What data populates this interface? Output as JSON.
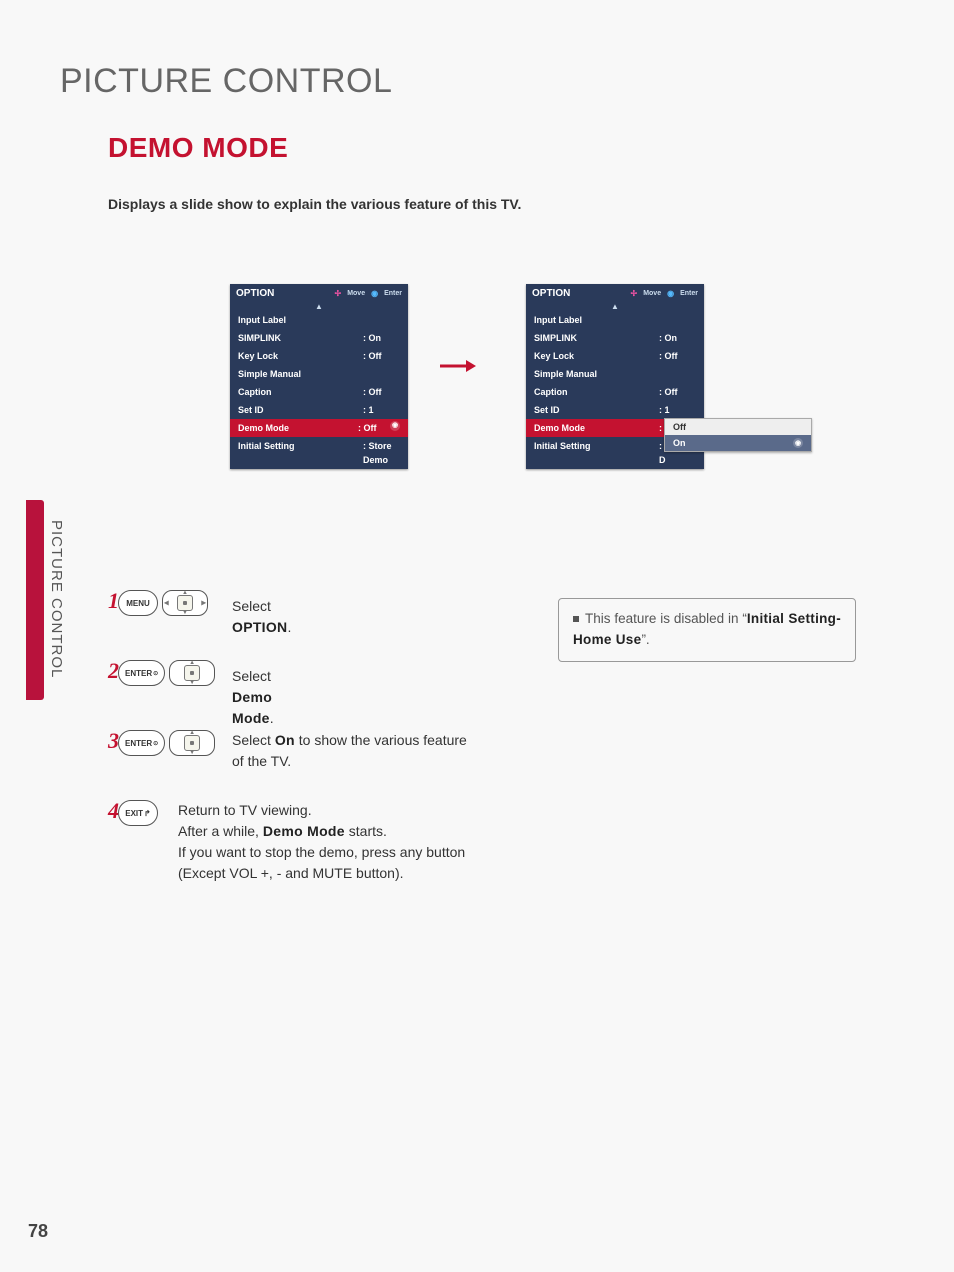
{
  "page_number": "78",
  "page_title": "PICTURE CONTROL",
  "section_title": "DEMO MODE",
  "description": "Displays a slide show to explain the various feature of this TV.",
  "side_label": "PICTURE CONTROL",
  "osd": {
    "title": "OPTION",
    "move": "Move",
    "enter": "Enter",
    "up_arrow": "▲",
    "rows": [
      {
        "label": "Input Label",
        "value": ""
      },
      {
        "label": "SIMPLINK",
        "value": ": On"
      },
      {
        "label": "Key Lock",
        "value": ": Off"
      },
      {
        "label": "Simple Manual",
        "value": ""
      },
      {
        "label": "Caption",
        "value": ": Off"
      },
      {
        "label": "Set ID",
        "value": ": 1"
      }
    ],
    "left_hl": {
      "label": "Demo Mode",
      "value": ": Off"
    },
    "left_last": {
      "label": "Initial Setting",
      "value": ": Store Demo"
    },
    "right_hl": {
      "label": "Demo Mode",
      "value": ": On"
    },
    "right_last": {
      "label": "Initial Setting",
      "value": ": Store D"
    }
  },
  "submenu": {
    "off": "Off",
    "on": "On"
  },
  "buttons": {
    "menu": "MENU",
    "enter": "ENTER",
    "exit": "EXIT"
  },
  "steps": {
    "s1_pre": "Select ",
    "s1_bold": "OPTION",
    "s1_post": ".",
    "s2_pre": "Select ",
    "s2_bold": "Demo Mode",
    "s2_post": ".",
    "s3_pre": "Select ",
    "s3_bold": "On",
    "s3_post": " to show the various feature of the TV.",
    "s4a": "Return to TV viewing.",
    "s4b_pre": "After a while, ",
    "s4b_bold": "Demo Mode",
    "s4b_post": " starts.",
    "s4c": "If you want to stop the demo, press any button (Except VOL +, - and MUTE button)."
  },
  "note": {
    "pre": "This feature is disabled in “",
    "bold": "Initial Setting-Home Use",
    "post": "”."
  }
}
